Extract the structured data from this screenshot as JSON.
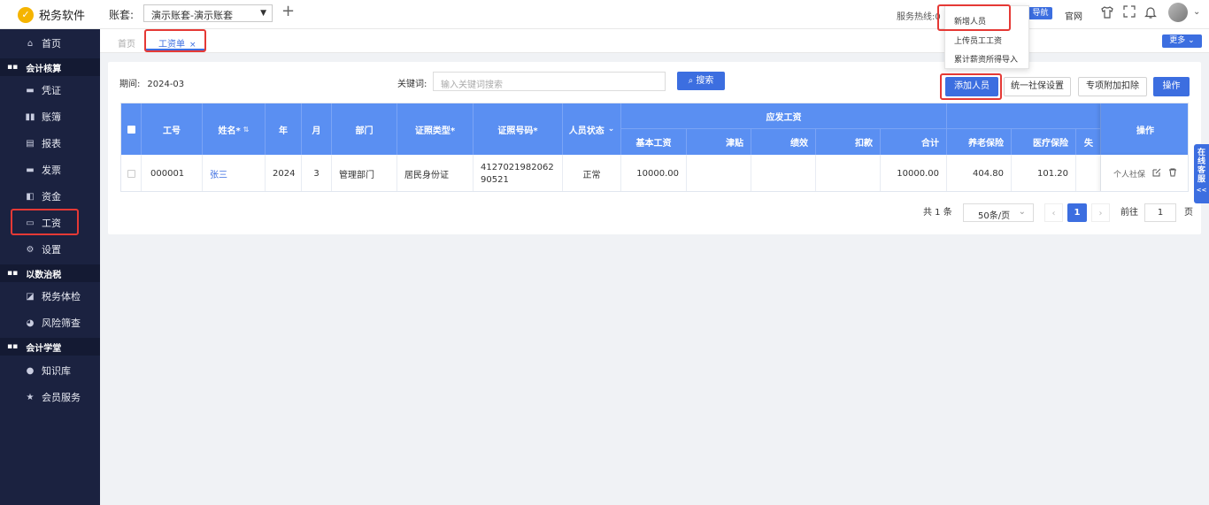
{
  "app": {
    "logo_glyph": "✓",
    "name": "税务软件"
  },
  "account": {
    "label": "账套:",
    "selected": "演示账套-演示账套"
  },
  "header": {
    "hotline_label": "服务热线:",
    "hotline_digit": "0",
    "nav_btn": "导航",
    "site_link": "官网"
  },
  "dropdown": {
    "items": [
      "新增人员",
      "上传员工工资",
      "累计薪资所得导入"
    ]
  },
  "sidebar": {
    "home": "首页",
    "groups": [
      {
        "label": "会计核算",
        "items": [
          "凭证",
          "账簿",
          "报表",
          "发票",
          "资金",
          "工资",
          "设置"
        ]
      },
      {
        "label": "以数治税",
        "items": [
          "税务体检",
          "风险筛查"
        ]
      },
      {
        "label": "会计学堂",
        "items": [
          "知识库",
          "会员服务"
        ]
      }
    ]
  },
  "tabs": {
    "home": "首页",
    "active": "工资单",
    "close": "×",
    "more": "更多 ⌄"
  },
  "toolbar": {
    "period_label": "期间:",
    "period_value": "2024-03",
    "keyword_label": "关键词:",
    "keyword_placeholder": "输入关键词搜索",
    "search": "搜索",
    "add_person": "添加人员",
    "social_setting": "统一社保设置",
    "special_deduction": "专项附加扣除",
    "operate": "操作"
  },
  "table": {
    "headers": {
      "id": "工号",
      "name": "姓名*",
      "year": "年",
      "month": "月",
      "dept": "部门",
      "cert_type": "证照类型*",
      "cert_no": "证照号码*",
      "status": "人员状态",
      "salary_group": "应发工资",
      "base": "基本工资",
      "allowance": "津贴",
      "performance": "绩效",
      "deduction": "扣款",
      "total": "合计",
      "pension": "养老保险",
      "medical": "医疗保险",
      "unemployment": "失",
      "ops": "操作"
    },
    "row": {
      "id": "000001",
      "name": "张三",
      "year": "2024",
      "month": "3",
      "dept": "管理部门",
      "cert_type": "居民身份证",
      "cert_no": "412702198206290521",
      "status": "正常",
      "base": "10000.00",
      "allowance": "",
      "performance": "",
      "deduction": "",
      "total": "10000.00",
      "pension": "404.80",
      "medical": "101.20",
      "op_link": "个人社保"
    }
  },
  "pagination": {
    "total": "共 1 条",
    "page_size": "50条/页",
    "prev": "‹",
    "current": "1",
    "next": "›",
    "goto_label": "前往",
    "goto_value": "1",
    "page_unit": "页"
  },
  "service": {
    "label": "在线客服",
    "arrows": "<<"
  },
  "colors": {
    "accent": "#3c6ee0",
    "sidebar": "#1b2240",
    "header": "#5a8ff2",
    "highlight": "#e53935"
  }
}
